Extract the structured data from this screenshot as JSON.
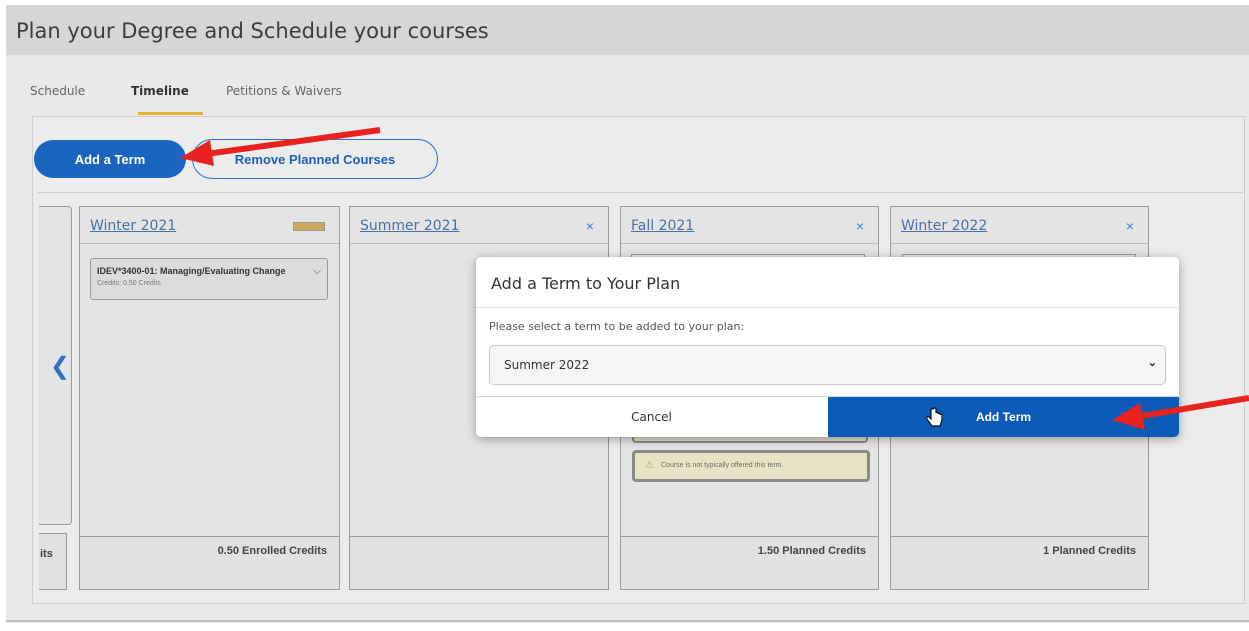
{
  "page": {
    "title": "Plan your Degree and Schedule your courses"
  },
  "tabs": [
    {
      "label": "Schedule",
      "active": false
    },
    {
      "label": "Timeline",
      "active": true
    },
    {
      "label": "Petitions & Waivers",
      "active": false
    }
  ],
  "toolbar": {
    "add_term_label": "Add a Term",
    "remove_planned_label": "Remove Planned Courses"
  },
  "timeline": {
    "prev_card_footer": "its",
    "terms": [
      {
        "title": "Winter 2021",
        "course": {
          "title": "IDEV*3400-01: Managing/Evaluating Change",
          "credits": "Credits: 0.50 Credits"
        },
        "footer": "0.50 Enrolled Credits"
      },
      {
        "title": "Summer 2021",
        "close": "×",
        "footer": ""
      },
      {
        "title": "Fall 2021",
        "close": "×",
        "warning": "Course is not typically offered this term.",
        "footer": "1.50 Planned Credits"
      },
      {
        "title": "Winter 2022",
        "close": "×",
        "footer": "1 Planned Credits"
      }
    ]
  },
  "modal": {
    "title": "Add a Term to Your Plan",
    "label": "Please select a term to be added to your plan:",
    "selected_term": "Summer 2022",
    "cancel_label": "Cancel",
    "add_label": "Add Term"
  },
  "colors": {
    "primary": "#0a5cb8",
    "annotation_arrow": "#e8221f",
    "tab_underline": "#e6b43c"
  }
}
